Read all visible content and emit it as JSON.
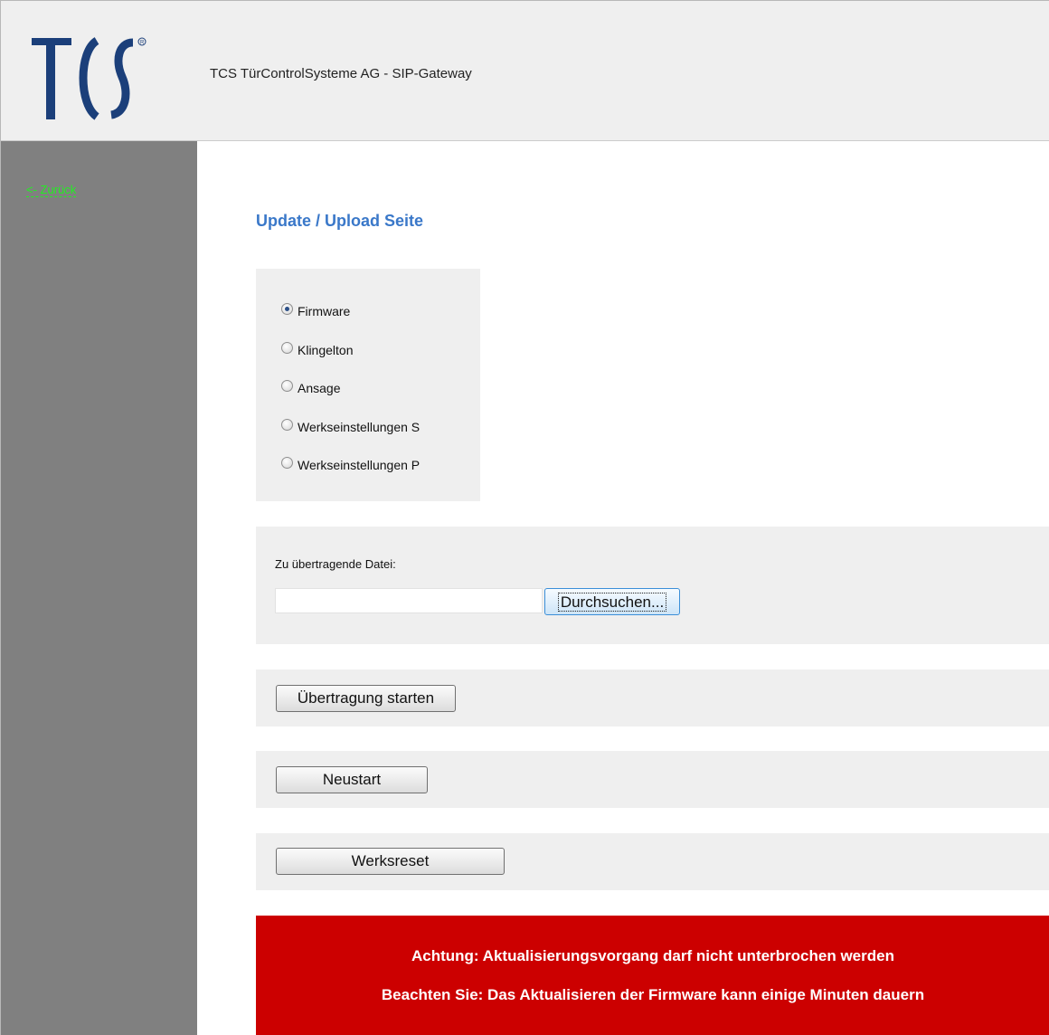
{
  "header": {
    "logo_text": "TCS",
    "title": "TCS TürControlSysteme AG - SIP-Gateway"
  },
  "sidebar": {
    "back_link": "<- Zurück"
  },
  "main": {
    "page_title": "Update / Upload Seite",
    "upload_type": {
      "selected": "Firmware",
      "options": [
        {
          "label": "Firmware",
          "checked": true
        },
        {
          "label": "Klingelton",
          "checked": false
        },
        {
          "label": "Ansage",
          "checked": false
        },
        {
          "label": "Werkseinstellungen S",
          "checked": false
        },
        {
          "label": "Werkseinstellungen P",
          "checked": false
        }
      ]
    },
    "file": {
      "label": "Zu übertragende Datei:",
      "value": "",
      "browse_label": "Durchsuchen..."
    },
    "start_transfer_label": "Übertragung starten",
    "restart_label": "Neustart",
    "factory_reset_label": "Werksreset",
    "warning": {
      "line1": "Achtung: Aktualisierungsvorgang darf nicht unterbrochen werden",
      "line2": "Beachten Sie: Das Aktualisieren der Firmware kann einige Minuten dauern"
    }
  },
  "colors": {
    "header_bg": "#efefef",
    "sidebar_bg": "#808080",
    "link_green": "#22ee22",
    "title_blue": "#3a78c9",
    "logo_blue": "#1b3f7a",
    "warning_red": "#cc0000"
  }
}
